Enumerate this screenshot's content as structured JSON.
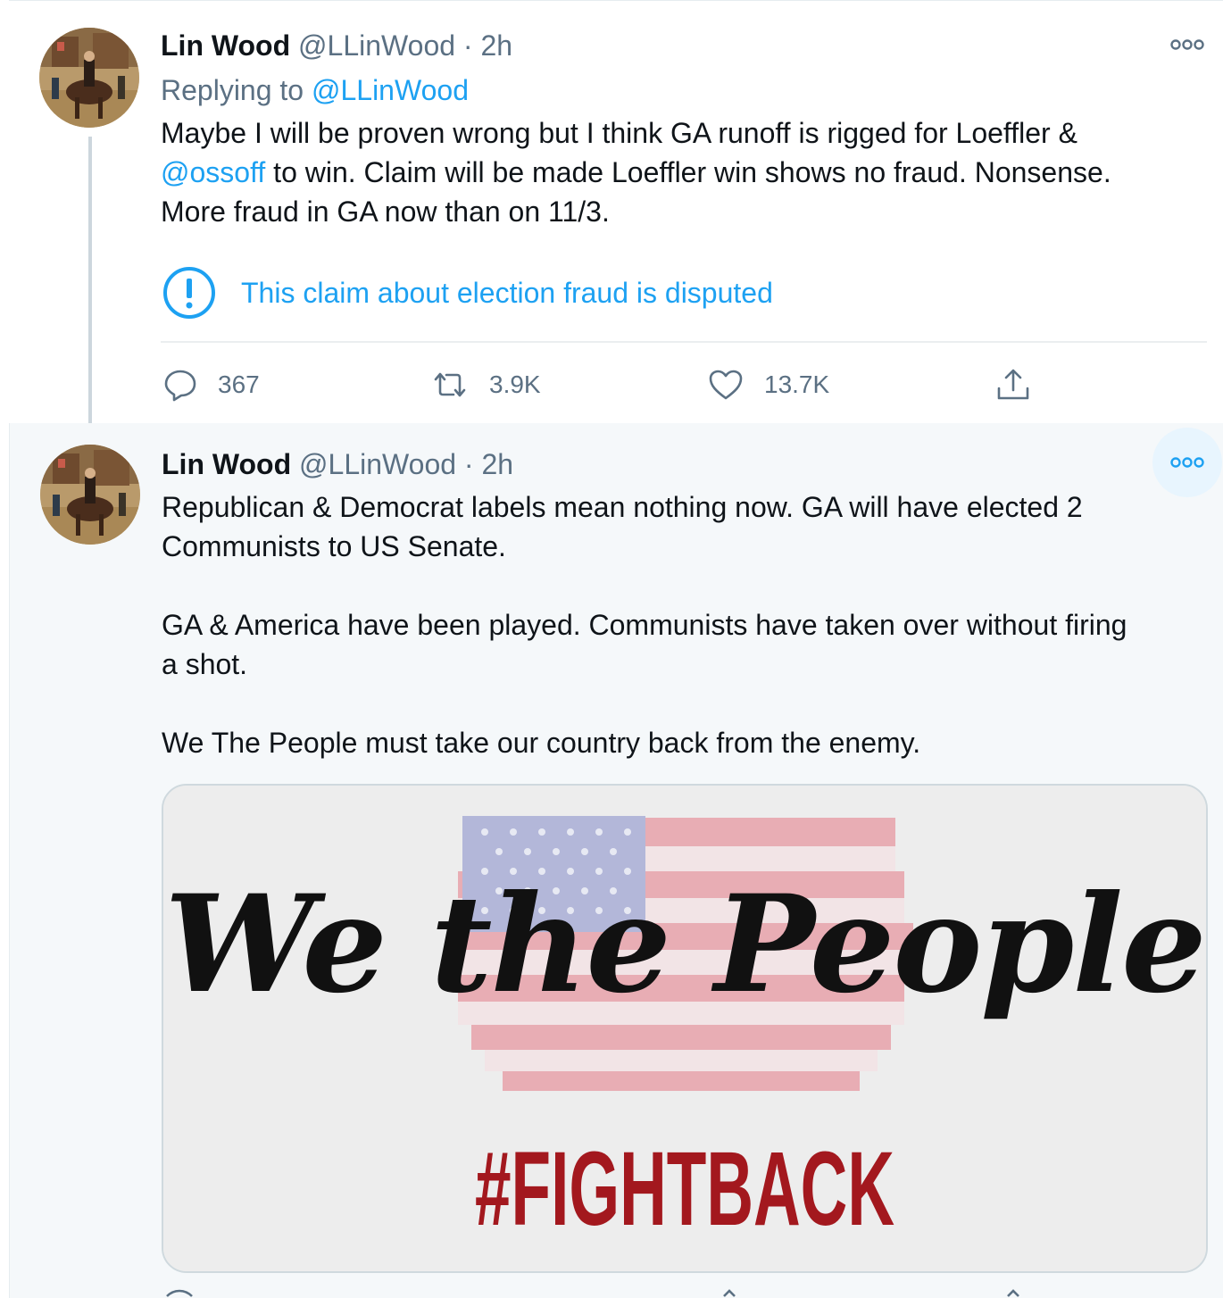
{
  "tweets": [
    {
      "name": "Lin Wood",
      "handle": "@LLinWood",
      "separator": "·",
      "time": "2h",
      "replying_prefix": "Replying to",
      "replying_to": "@LLinWood",
      "text_lines": [
        "Maybe I will be proven wrong but I think GA runoff is rigged for Loeffler &",
        "to win. Claim will be made Loeffler win shows no fraud. Nonsense.",
        "More fraud in GA now than on 11/3."
      ],
      "mention": "@ossoff",
      "notice": "This claim about election fraud is disputed",
      "actions": {
        "replies": "367",
        "retweets": "3.9K",
        "likes": "13.7K"
      }
    },
    {
      "name": "Lin Wood",
      "handle": "@LLinWood",
      "separator": "·",
      "time": "2h",
      "text_lines": [
        "Republican & Democrat labels mean nothing now. GA will have elected 2",
        "Communists to US Senate.",
        "GA & America have been played. Communists have taken over without firing",
        "a shot.",
        "We The People must take our country back from the enemy."
      ],
      "image": {
        "script_text": "We the People",
        "hashtag": "#FIGHTBACK"
      }
    }
  ],
  "icons": {
    "more": "more-horizontal-icon",
    "reply": "reply-icon",
    "retweet": "retweet-icon",
    "like": "heart-icon",
    "share": "share-icon",
    "notice": "exclamation-circle-icon"
  },
  "colors": {
    "link": "#1da1f2",
    "secondary_text": "#5b7083",
    "hashtag_red": "#a3181e",
    "flag_red": "#e8a3ab",
    "flag_blue": "#a9aed6"
  }
}
